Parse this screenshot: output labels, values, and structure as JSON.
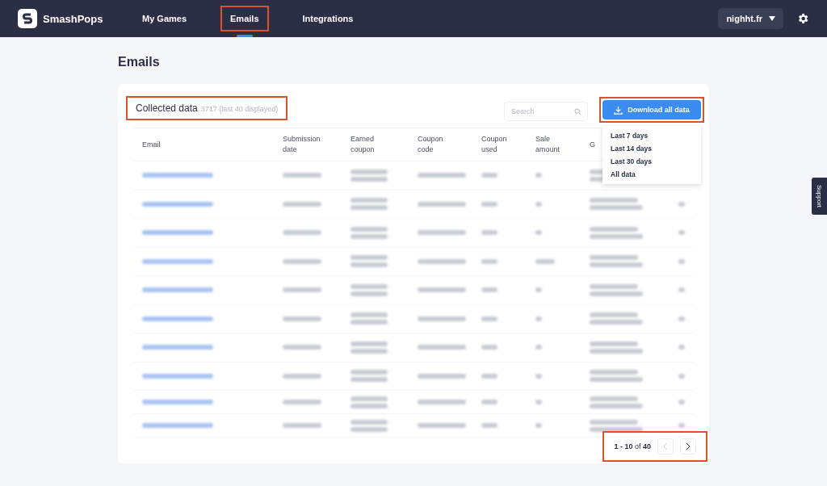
{
  "navbar": {
    "brand": "SmashPops",
    "links": [
      {
        "label": "My Games",
        "selected": false,
        "highlighted": false
      },
      {
        "label": "Emails",
        "selected": true,
        "highlighted": true
      },
      {
        "label": "Integrations",
        "selected": false,
        "highlighted": false
      }
    ],
    "account": "nighht.fr"
  },
  "page_title": "Emails",
  "card": {
    "title": "Collected data",
    "count": "3717",
    "count_note": "(last 40 displayed)",
    "title_highlighted": true,
    "search": {
      "placeholder": "Search"
    },
    "download": {
      "label": "Download all data",
      "highlighted": true,
      "menu": [
        "Last 7 days",
        "Last 14 days",
        "Last 30 days",
        "All data"
      ]
    },
    "table": {
      "columns": [
        "Email",
        "Submission date",
        "Earned coupon",
        "Coupon code",
        "Coupon used",
        "Sale amount",
        "G"
      ],
      "rows": [
        {
          "kind": "redacted",
          "sale_filled": false
        },
        {
          "kind": "redacted",
          "sale_filled": false
        },
        {
          "kind": "redacted",
          "sale_filled": false
        },
        {
          "kind": "redacted",
          "sale_filled": true
        },
        {
          "kind": "redacted",
          "sale_filled": false
        },
        {
          "kind": "redacted",
          "sale_filled": false
        },
        {
          "kind": "redacted",
          "sale_filled": false
        },
        {
          "kind": "redacted",
          "sale_filled": false
        },
        {
          "kind": "redacted",
          "sale_filled": false
        },
        {
          "kind": "redacted",
          "sale_filled": false
        }
      ]
    },
    "pagination": {
      "range": "1 - 10",
      "of": "of",
      "total": "40",
      "highlighted": true
    }
  },
  "support_tab": "Support"
}
